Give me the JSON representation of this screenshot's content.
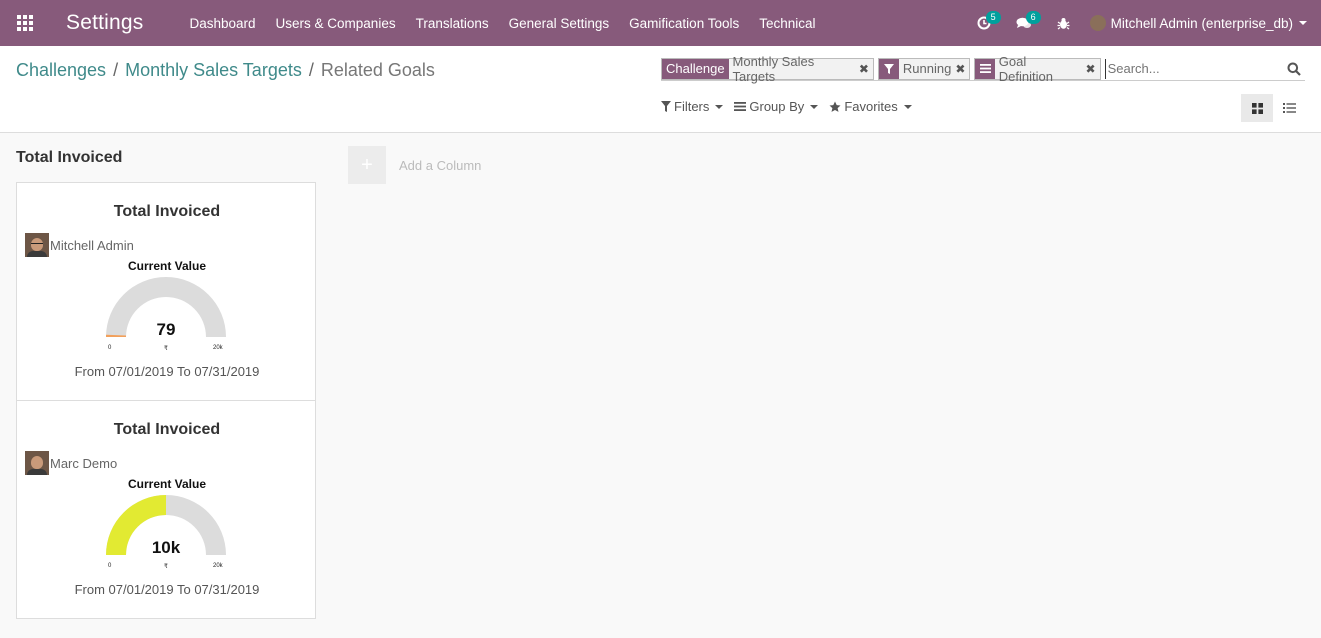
{
  "navbar": {
    "brand": "Settings",
    "menu": [
      "Dashboard",
      "Users & Companies",
      "Translations",
      "General Settings",
      "Gamification Tools",
      "Technical"
    ],
    "activity_count": "5",
    "message_count": "6",
    "user": "Mitchell Admin (enterprise_db)"
  },
  "breadcrumb": {
    "items": [
      "Challenges",
      "Monthly Sales Targets"
    ],
    "current": "Related Goals"
  },
  "search": {
    "facets": [
      {
        "category": "Challenge",
        "value": "Monthly Sales Targets"
      },
      {
        "icon": "filter-icon",
        "value": "Running"
      },
      {
        "icon": "groupby-icon",
        "value": "Goal Definition"
      }
    ],
    "placeholder": "Search..."
  },
  "controls": {
    "filters": "Filters",
    "group_by": "Group By",
    "favorites": "Favorites"
  },
  "kanban": {
    "column_title": "Total Invoiced",
    "add_column": "Add a Column",
    "cards": [
      {
        "title": "Total Invoiced",
        "user": "Mitchell Admin",
        "label": "Current Value",
        "value_display": "79",
        "value": 79,
        "max": 20000,
        "min_label": "0",
        "max_label": "20k",
        "unit": "₹",
        "color": "#f2a05b",
        "date_range": "From 07/01/2019 To 07/31/2019"
      },
      {
        "title": "Total Invoiced",
        "user": "Marc Demo",
        "label": "Current Value",
        "value_display": "10k",
        "value": 10000,
        "max": 20000,
        "min_label": "0",
        "max_label": "20k",
        "unit": "₹",
        "color": "#e2ea32",
        "date_range": "From 07/01/2019 To 07/31/2019"
      }
    ]
  }
}
